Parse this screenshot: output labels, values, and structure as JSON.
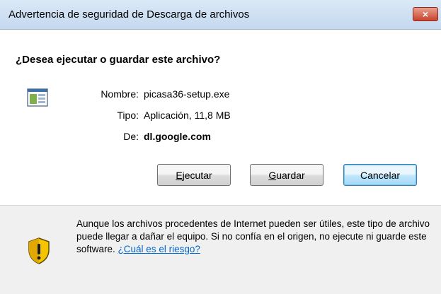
{
  "window": {
    "title": "Advertencia de seguridad de Descarga de archivos",
    "close_label": "×"
  },
  "dialog": {
    "question": "¿Desea ejecutar o guardar este archivo?",
    "file_icon": "executable-file-icon",
    "fields": {
      "name_label": "Nombre:",
      "name_value": "picasa36-setup.exe",
      "type_label": "Tipo:",
      "type_value": "Aplicación, 11,8 MB",
      "from_label": "De:",
      "from_value": "dl.google.com"
    },
    "buttons": {
      "run_accel": "E",
      "run_rest": "jecutar",
      "save_accel": "G",
      "save_rest": "uardar",
      "cancel": "Cancelar"
    }
  },
  "warning": {
    "icon": "security-shield-icon",
    "text": "Aunque los archivos procedentes de Internet pueden ser útiles, este tipo de archivo puede llegar a dañar el equipo. Si no confía en el origen, no ejecute ni guarde este software.",
    "link": "¿Cuál es el riesgo?"
  },
  "colors": {
    "titlebar": "#c4d8ee",
    "close_button": "#c8432d",
    "warning_panel": "#f0f0f0",
    "link": "#0066cc",
    "shield_yellow": "#f5c400"
  }
}
